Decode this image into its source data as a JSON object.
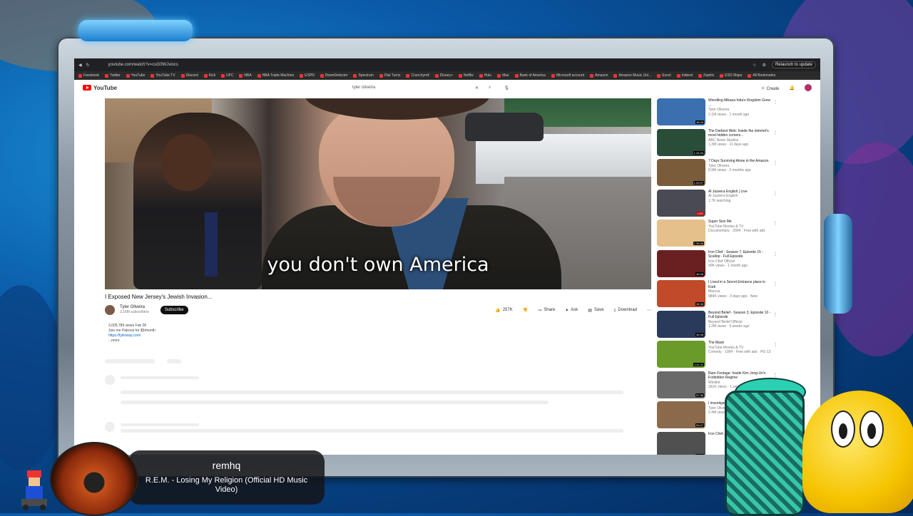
{
  "browser": {
    "url": "youtube.com/watch?v=cuG0WJviocs",
    "relaunch_label": "Relaunch to update",
    "bookmarks": [
      "Facebook",
      "Twitter",
      "YouTube",
      "YouTube TV",
      "Discord",
      "Kick",
      "UFC",
      "NBA",
      "NBA Trade Machine",
      "ESPN",
      "DownDetector",
      "Spectrum",
      "Dial Turns",
      "Crunchyroll",
      "Disney+",
      "Netflix",
      "Hulu",
      "Max",
      "Bank of America",
      "Microsoft account",
      "Amazon",
      "Amazon Music Unl...",
      "Excel",
      "Indeed",
      "Zaptrix",
      "ESO Maps",
      "All Bookmarks"
    ]
  },
  "youtube": {
    "logo": "YouTube",
    "search_query": "tyler oliveira",
    "create_label": "Create"
  },
  "video": {
    "caption": "you don't own America",
    "title": "I Exposed New Jersey's Jewish Invasion...",
    "channel": "Tyler Oliveira",
    "subscribers": "3.16M subscribers",
    "subscribe_label": "Subscribe",
    "likes": "257K",
    "share_label": "Share",
    "ask_label": "Ask",
    "save_label": "Save",
    "download_label": "Download",
    "views": "3,005,789 views  Feb 28",
    "desc_line": "Join me Patreon for $5/month",
    "desc_link": "https://tylerway.com/",
    "more_label": "...more"
  },
  "recommendations": [
    {
      "title": "Wrestling Mikasa Inda's Kingdom Grew ...",
      "channel": "Tyler Oliveira",
      "meta": "2.1M views · 1 month ago",
      "duration": "48:26",
      "color": "#3a6fb0"
    },
    {
      "title": "The Darkest Web: Inside the internet's most hidden corners...",
      "channel": "ABC News Studios",
      "meta": "1.3M views · 11 days ago",
      "duration": "1:24:34",
      "color": "#2a4d3a"
    },
    {
      "title": "7 Days Surviving Alone in the Amazon",
      "channel": "Tyler Oliveira",
      "meta": "8.9M views · 2 months ago",
      "duration": "1:20:07",
      "color": "#7a5c3a"
    },
    {
      "title": "Al Jazeera English | Live",
      "channel": "Al Jazeera English",
      "meta": "1.7K watching",
      "duration": "LIVE",
      "color": "#4a4a52"
    },
    {
      "title": "Super Size Me",
      "channel": "YouTube Movies & TV",
      "meta": "Documentary · 2004 · Free with ads",
      "duration": "1:39:58",
      "color": "#e6c08a"
    },
    {
      "title": "Iron Chef - Season 7, Episode 15 - Scallop - Full Episode",
      "channel": "Iron Chef Official",
      "meta": "40K views · 1 month ago",
      "duration": "45:26",
      "color": "#6a2020"
    },
    {
      "title": "I Lived in a Secret Entrance place in Kodi",
      "channel": "Marcus",
      "meta": "984K views · 3 days ago · New",
      "duration": "38:30",
      "color": "#c04a2a"
    },
    {
      "title": "Beyond Belief - Season 3, Episode 10 - Full Episode",
      "channel": "Beyond Belief Official",
      "meta": "1.2M views · 5 weeks ago",
      "duration": "45:38",
      "color": "#2a3a5a"
    },
    {
      "title": "The Mask",
      "channel": "YouTube Movies & TV",
      "meta": "Comedy · 1994 · Free with ads · PG-13",
      "duration": "1:41:11",
      "color": "#6a9a2a"
    },
    {
      "title": "Rare Footage: Inside Kim Jong-Un's Forbidden Regime",
      "channel": "Wristlet",
      "meta": "181K views · 1 week ago",
      "duration": "57:36",
      "color": "#6a6a6a"
    },
    {
      "title": "I investigated the world's banned...",
      "channel": "Tyler Oliveira",
      "meta": "2.4M views",
      "duration": "53:47",
      "color": "#8a6a4a"
    },
    {
      "title": "Iron Chef...",
      "channel": "",
      "meta": "",
      "duration": "46:12",
      "color": "#505050"
    }
  ],
  "now_playing": {
    "user": "remhq",
    "song": "R.E.M. - Losing My Religion (Official HD Music Video)"
  }
}
